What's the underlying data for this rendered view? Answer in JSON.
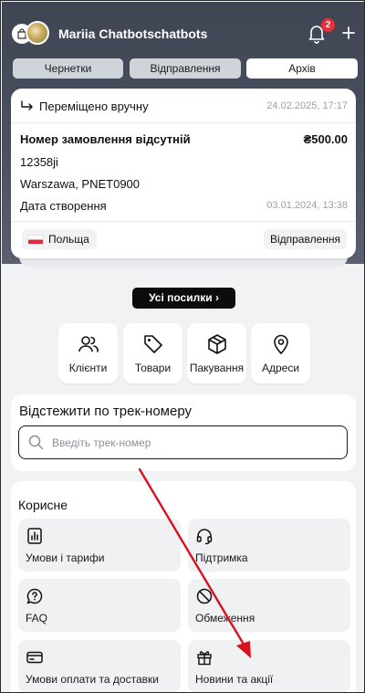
{
  "colors": {
    "header_bg": "#3f4552",
    "accent_dark": "#0c0c0c",
    "badge_red": "#e2313b",
    "annotation_red": "#d8121c"
  },
  "header": {
    "username": "Mariia Chatbotschatbots",
    "notification_count": "2"
  },
  "tabs": [
    {
      "label": "Чернетки",
      "active": false
    },
    {
      "label": "Відправлення",
      "active": false
    },
    {
      "label": "Архів",
      "active": true
    }
  ],
  "shipment": {
    "status_text": "Переміщено вручну",
    "status_date": "24.02.2025, 17:17",
    "order_title": "Номер замовлення відсутній",
    "amount": "₴500.00",
    "tracking": "12358ji",
    "address": "Warszawa, PNET0900",
    "created_label": "Дата створення",
    "created_date": "03.01.2024, 13:38",
    "country": "Польща",
    "stage": "Відправлення"
  },
  "all_parcels_button": "Усі посилки",
  "quick_actions": [
    {
      "label": "Клієнти",
      "icon": "users-icon"
    },
    {
      "label": "Товари",
      "icon": "tag-icon"
    },
    {
      "label": "Пакування",
      "icon": "box-icon"
    },
    {
      "label": "Адреси",
      "icon": "map-pin-icon"
    }
  ],
  "tracking_search": {
    "title": "Відстежити по трек-номеру",
    "placeholder": "Введіть трек-номер"
  },
  "useful": {
    "title": "Корисне",
    "items": [
      {
        "label": "Умови і тарифи",
        "icon": "chart-icon"
      },
      {
        "label": "Підтримка",
        "icon": "headset-icon"
      },
      {
        "label": "FAQ",
        "icon": "question-chat-icon"
      },
      {
        "label": "Обмеження",
        "icon": "prohibited-icon"
      },
      {
        "label": "Умови оплати та доставки",
        "icon": "card-icon"
      },
      {
        "label": "Новини та акції",
        "icon": "gift-icon"
      }
    ]
  }
}
